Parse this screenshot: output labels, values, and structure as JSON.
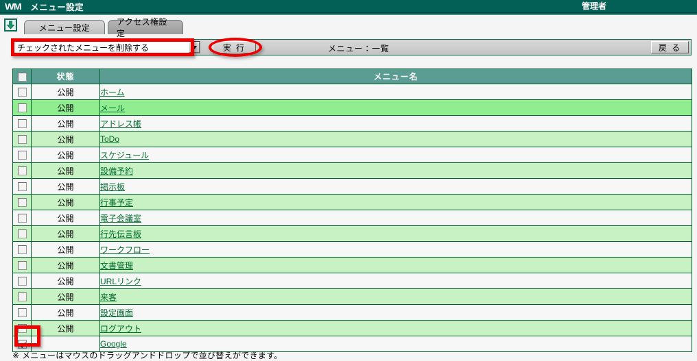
{
  "window": {
    "logo": "WM",
    "title": "メニュー設定",
    "user": "管理者"
  },
  "toolbar": {
    "collapse_icon": "down-arrow-icon",
    "tabs": [
      {
        "label": "メニュー設定",
        "active": true
      },
      {
        "label": "アクセス権設定",
        "active": false
      }
    ]
  },
  "actionbar": {
    "action_select_value": "チェックされたメニューを削除する",
    "dropdown_icon": "chevron-down-icon",
    "execute_label": "実 行",
    "caption": "メニュー：一覧",
    "back_label": "戻 る"
  },
  "table": {
    "headers": {
      "check": "",
      "state": "状態",
      "name": "メニュー名"
    },
    "header_checkbox_checked": false,
    "rows": [
      {
        "checked": false,
        "state": "公開",
        "name": "ホーム",
        "style": "plain"
      },
      {
        "checked": false,
        "state": "公開",
        "name": "メール",
        "style": "highlight"
      },
      {
        "checked": false,
        "state": "公開",
        "name": "アドレス帳",
        "style": "plain"
      },
      {
        "checked": false,
        "state": "公開",
        "name": "ToDo",
        "style": "alt"
      },
      {
        "checked": false,
        "state": "公開",
        "name": "スケジュール",
        "style": "plain"
      },
      {
        "checked": false,
        "state": "公開",
        "name": "設備予約",
        "style": "alt"
      },
      {
        "checked": false,
        "state": "公開",
        "name": "掲示板",
        "style": "plain"
      },
      {
        "checked": false,
        "state": "公開",
        "name": "行事予定",
        "style": "alt"
      },
      {
        "checked": false,
        "state": "公開",
        "name": "電子会議室",
        "style": "plain"
      },
      {
        "checked": false,
        "state": "公開",
        "name": "行先伝言板",
        "style": "alt"
      },
      {
        "checked": false,
        "state": "公開",
        "name": "ワークフロー",
        "style": "plain"
      },
      {
        "checked": false,
        "state": "公開",
        "name": "文書管理",
        "style": "alt"
      },
      {
        "checked": false,
        "state": "公開",
        "name": "URLリンク",
        "style": "plain"
      },
      {
        "checked": false,
        "state": "公開",
        "name": "来客",
        "style": "alt"
      },
      {
        "checked": false,
        "state": "公開",
        "name": "設定画面",
        "style": "plain"
      },
      {
        "checked": false,
        "state": "公開",
        "name": "ログアウト",
        "style": "alt"
      },
      {
        "checked": true,
        "state": "",
        "name": "Google",
        "style": "plain"
      }
    ]
  },
  "footer": {
    "note": "※ メニューはマウスのドラッグアンドドロップで並び替えができます。"
  },
  "annotations": {
    "color": "#ee0000",
    "shapes": [
      "rect-around-action-select",
      "ellipse-around-execute-button",
      "rect-around-last-row-checkbox"
    ]
  }
}
